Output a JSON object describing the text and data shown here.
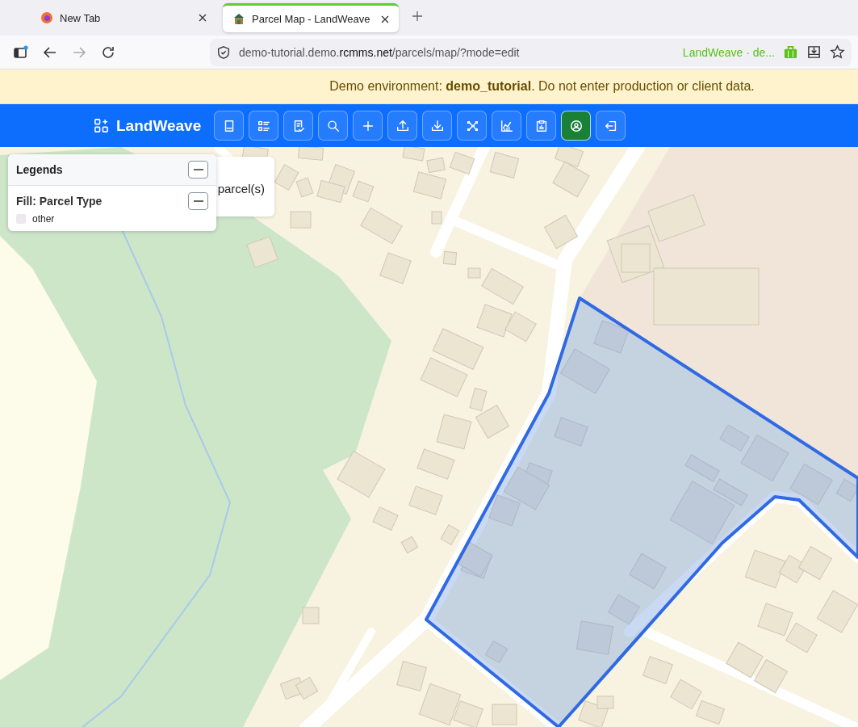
{
  "browser": {
    "tabs": [
      {
        "title": "New Tab",
        "selected": false
      },
      {
        "title": "Parcel Map - LandWeave",
        "selected": true
      }
    ],
    "url": {
      "host_prefix": "demo-tutorial.demo.",
      "host_domain": "rcmms.net",
      "path": "/parcels/map/?mode=edit"
    },
    "site_label": "LandWeave · de..."
  },
  "banner": {
    "text": "Demo environment: **demo_tutorial**. Do not enter production or client data."
  },
  "navbar": {
    "brand": "LandWeave",
    "buttons": [
      {
        "selected": false
      },
      {
        "selected": false
      },
      {
        "selected": false
      },
      {
        "selected": false
      },
      {
        "selected": false
      },
      {
        "selected": false
      },
      {
        "selected": false
      },
      {
        "selected": false
      },
      {
        "selected": false
      },
      {
        "selected": false
      },
      {
        "selected": true
      },
      {
        "selected": false
      }
    ]
  },
  "map": {
    "info_card": {
      "text": "parcel(s)"
    },
    "legend": {
      "title": "Legends",
      "section_title": "Fill: Parcel Type",
      "items": [
        {
          "label": "other",
          "color": "#ede8ee"
        }
      ]
    }
  }
}
